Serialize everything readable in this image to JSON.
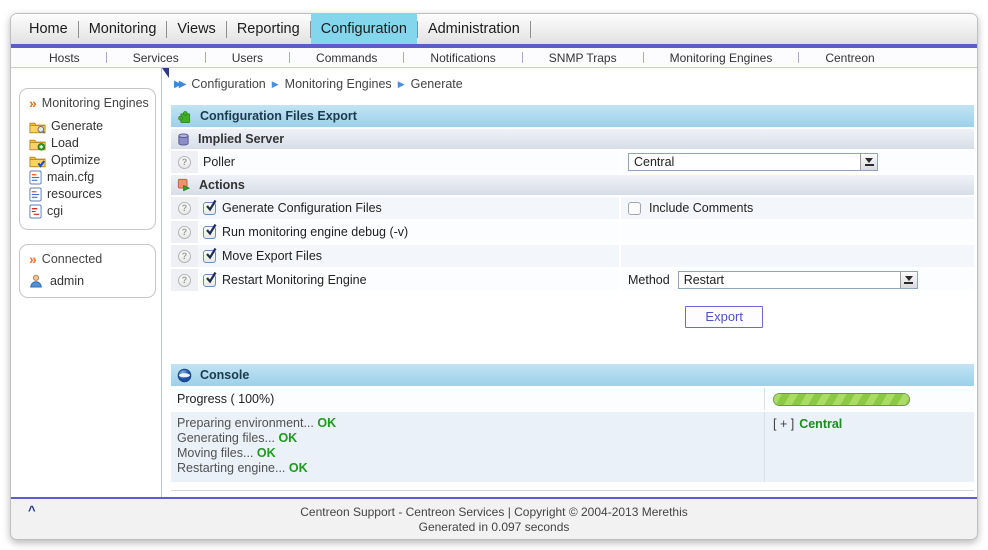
{
  "icons": {
    "chevron": "»",
    "double_arrow": "▶▶",
    "breadcrumb_arrow": "▶",
    "help": "?"
  },
  "colors": {
    "accent_purple": "#5d5dc8",
    "active_tab_cyan": "#83d6ec",
    "ok_green": "#1e9b1e",
    "progress_green": "#8bc944",
    "header_blue": "#9cd0ea"
  },
  "top_nav": {
    "tabs": [
      {
        "label": "Home"
      },
      {
        "label": "Monitoring"
      },
      {
        "label": "Views"
      },
      {
        "label": "Reporting"
      },
      {
        "label": "Configuration"
      },
      {
        "label": "Administration"
      }
    ],
    "active_tab": "Configuration"
  },
  "sub_nav": {
    "items": [
      {
        "label": "Hosts"
      },
      {
        "label": "Services"
      },
      {
        "label": "Users"
      },
      {
        "label": "Commands"
      },
      {
        "label": "Notifications"
      },
      {
        "label": "SNMP Traps"
      },
      {
        "label": "Monitoring Engines"
      },
      {
        "label": "Centreon"
      }
    ]
  },
  "sidebar": {
    "section_title": "Monitoring Engines",
    "items": [
      {
        "label": "Generate",
        "icon": "folder-generate-icon"
      },
      {
        "label": "Load",
        "icon": "folder-add-icon"
      },
      {
        "label": "Optimize",
        "icon": "folder-check-icon"
      },
      {
        "label": "main.cfg",
        "icon": "config-file-icon"
      },
      {
        "label": "resources",
        "icon": "config-file-icon"
      },
      {
        "label": "cgi",
        "icon": "cgi-file-icon"
      }
    ],
    "connected_title": "Connected",
    "user": "admin"
  },
  "breadcrumb": {
    "items": [
      {
        "label": "Configuration"
      },
      {
        "label": "Monitoring Engines"
      },
      {
        "label": "Generate"
      }
    ]
  },
  "export_panel": {
    "title": "Configuration Files Export",
    "implied_server_header": "Implied Server",
    "poller_label": "Poller",
    "poller_value": "Central",
    "actions_header": "Actions",
    "actions": [
      {
        "label": "Generate Configuration Files",
        "checked": true
      },
      {
        "label": "Run monitoring engine debug (-v)",
        "checked": true
      },
      {
        "label": "Move Export Files",
        "checked": true
      },
      {
        "label": "Restart Monitoring Engine",
        "checked": true
      }
    ],
    "include_comments_label": "Include Comments",
    "include_comments_checked": false,
    "method_label": "Method",
    "method_value": "Restart",
    "export_button": "Export"
  },
  "console": {
    "title": "Console",
    "progress_label": "Progress ( 100%)",
    "progress_percent": 100,
    "log_lines": [
      {
        "text": "Preparing environment...",
        "status": "OK"
      },
      {
        "text": "Generating files...",
        "status": "OK"
      },
      {
        "text": "Moving files...",
        "status": "OK"
      },
      {
        "text": "Restarting engine...",
        "status": "OK"
      }
    ],
    "expander": "[ + ]",
    "poller_name": "Central"
  },
  "footer": {
    "line1": "Centreon Support - Centreon Services | Copyright © 2004-2013 Merethis",
    "line2": "Generated in 0.097 seconds",
    "caret": "^"
  }
}
